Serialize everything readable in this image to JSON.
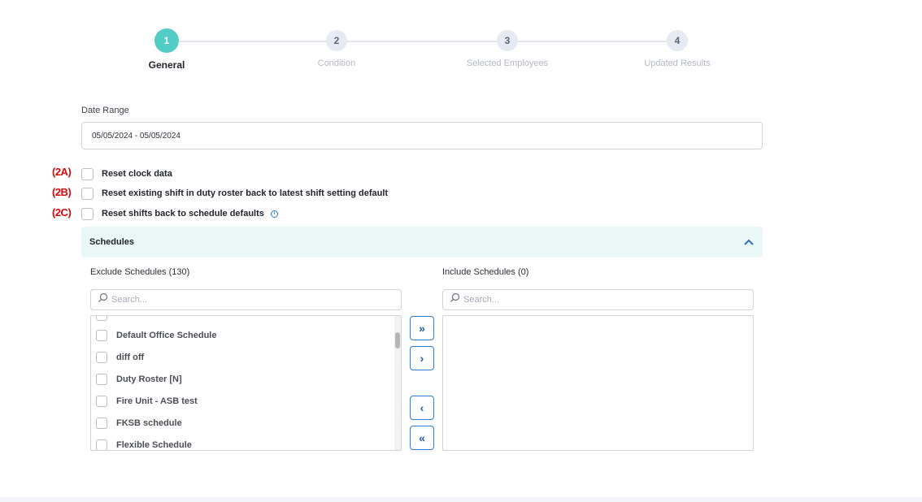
{
  "stepper": {
    "steps": [
      {
        "number": "1",
        "label": "General",
        "active": true
      },
      {
        "number": "2",
        "label": "Condition",
        "active": false
      },
      {
        "number": "3",
        "label": "Selected Employees",
        "active": false
      },
      {
        "number": "4",
        "label": "Updated Results",
        "active": false
      }
    ]
  },
  "date_range": {
    "label": "Date Range",
    "value": "05/05/2024 - 05/05/2024"
  },
  "options": [
    {
      "annotation": "(2A)",
      "label": "Reset clock data",
      "checked": false
    },
    {
      "annotation": "(2B)",
      "label": "Reset existing shift in duty roster back to latest shift setting default",
      "checked": false
    },
    {
      "annotation": "(2C)",
      "label": "Reset shifts back to schedule defaults",
      "checked": false,
      "info_icon": "info-icon"
    }
  ],
  "schedules": {
    "title": "Schedules",
    "toggle_icon": "chevron-up-icon",
    "exclude": {
      "title": "Exclude Schedules (130)",
      "search_placeholder": "Search...",
      "items": [
        "Default Office Schedule",
        "diff off",
        "Duty Roster [N]",
        "Fire Unit - ASB test",
        "FKSB schedule",
        "Flexible Schedule"
      ]
    },
    "include": {
      "title": "Include Schedules (0)",
      "search_placeholder": "Search...",
      "items": []
    },
    "buttons": {
      "move_all_right": "»",
      "move_right": "›",
      "move_left": "‹",
      "move_all_left": "«"
    }
  },
  "colors": {
    "accent": "#52cdc6",
    "link_blue": "#2f7bd6",
    "annotation_red": "#d20a0a"
  }
}
